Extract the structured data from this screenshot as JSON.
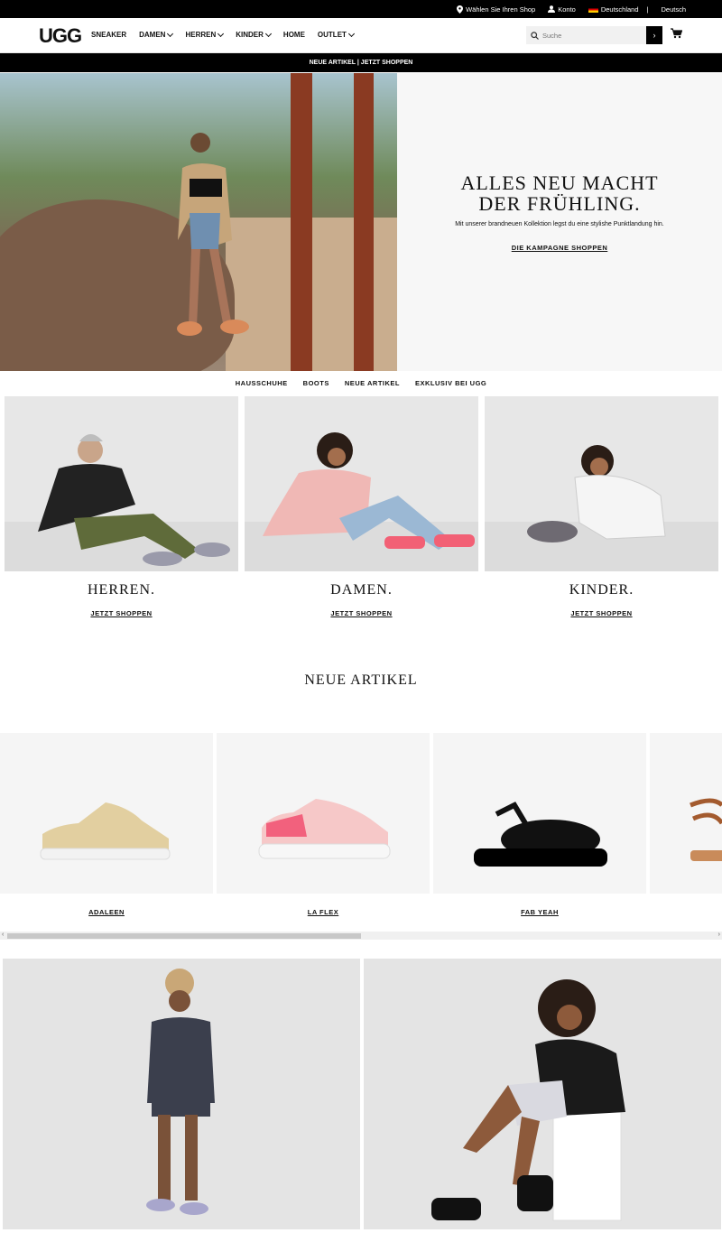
{
  "topbar": {
    "store_label": "Wählen Sie Ihren Shop",
    "account_label": "Konto",
    "country_label": "Deutschland",
    "separator": "|",
    "language_label": "Deutsch"
  },
  "nav": {
    "logo": "UGG",
    "items": [
      {
        "label": "SNEAKER",
        "dropdown": false
      },
      {
        "label": "DAMEN",
        "dropdown": true
      },
      {
        "label": "HERREN",
        "dropdown": true
      },
      {
        "label": "KINDER",
        "dropdown": true
      },
      {
        "label": "HOME",
        "dropdown": false
      },
      {
        "label": "OUTLET",
        "dropdown": true
      }
    ],
    "search_placeholder": "Suche"
  },
  "promo": {
    "text": "NEUE ARTIKEL | JETZT SHOPPEN"
  },
  "hero": {
    "headline_line1": "ALLES NEU MACHT",
    "headline_line2": "DER FRÜHLING.",
    "subtext": "Mit unserer brandneuen Kollektion legst du eine stylishe Punktlandung hin.",
    "cta": "DIE KAMPAGNE SHOPPEN"
  },
  "categories": [
    "HAUSSCHUHE",
    "BOOTS",
    "NEUE ARTIKEL",
    "EXKLUSIV BEI UGG"
  ],
  "tiles": [
    {
      "title": "HERREN.",
      "cta": "JETZT SHOPPEN"
    },
    {
      "title": "DAMEN.",
      "cta": "JETZT SHOPPEN"
    },
    {
      "title": "KINDER.",
      "cta": "JETZT SHOPPEN"
    }
  ],
  "new_arrivals": {
    "heading": "NEUE ARTIKEL",
    "products": [
      "ADALEEN",
      "LA FLEX",
      "FAB YEAH"
    ],
    "scroll_left": "‹",
    "scroll_right": "›"
  },
  "colors": {
    "accent": "#000000",
    "tile_bg": "#e7e7e7",
    "hero_panel": "#f7f7f7"
  }
}
